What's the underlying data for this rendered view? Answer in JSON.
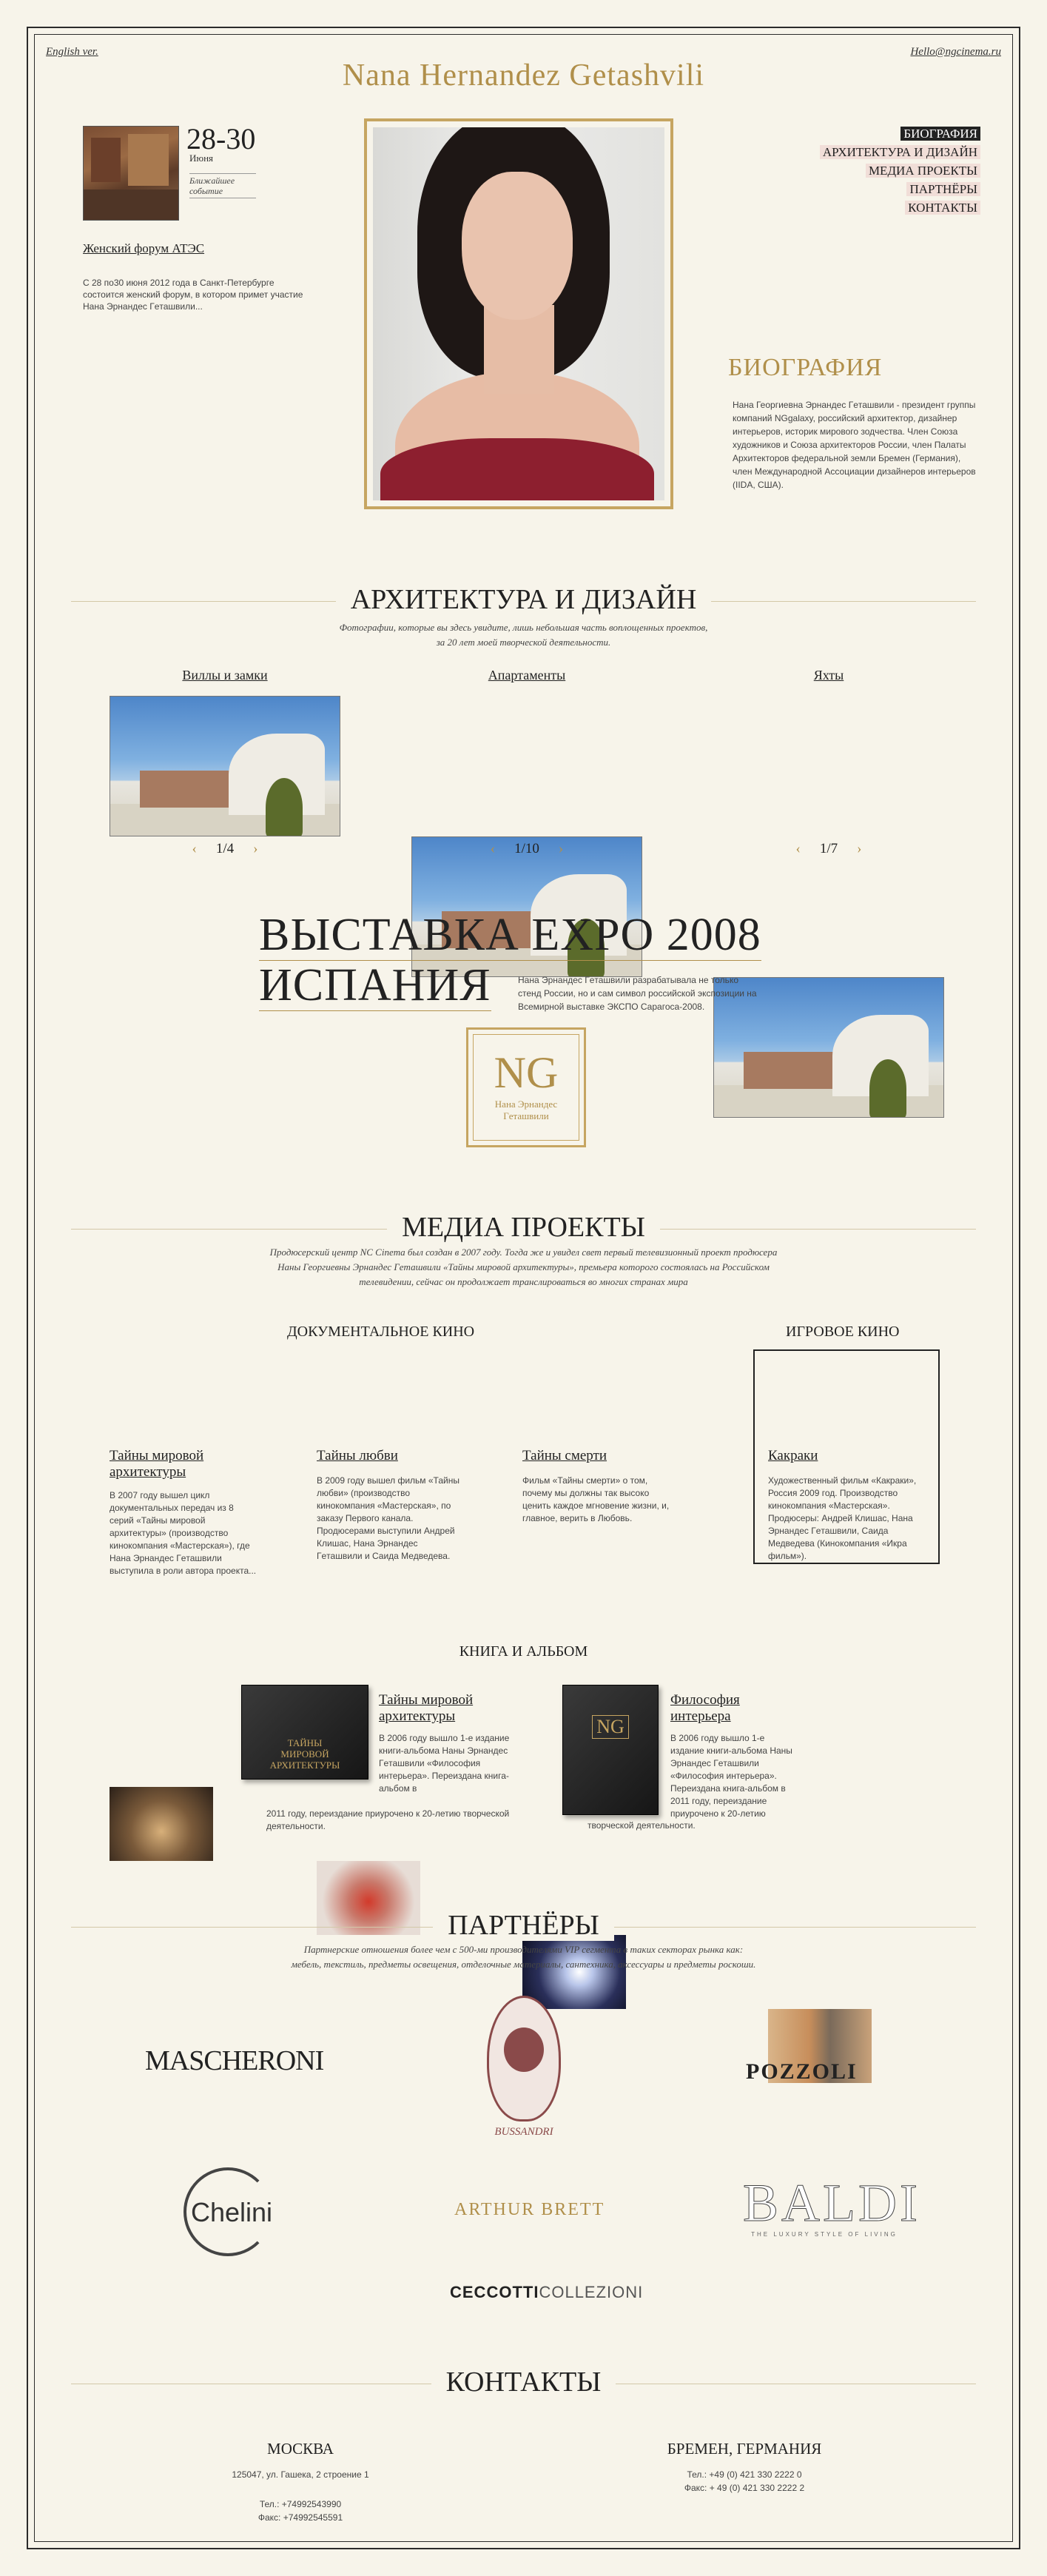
{
  "header": {
    "lang_link": "English ver.",
    "email": "Hello@ngcinema.ru",
    "site_title": "Nana Hernandez Getashvili"
  },
  "event": {
    "date": "28-30",
    "month": "Июня",
    "label": "Ближайшее событие",
    "title": "Женский форум АТЭС",
    "text": "С 28 по30 июня 2012 года в Санкт-Петербурге состоится женский форум, в котором примет участие Нана Эрнандес Гeташвили..."
  },
  "nav": {
    "items": [
      {
        "label": "Биография",
        "active": true
      },
      {
        "label": "Архитектура и дизайн",
        "active": false
      },
      {
        "label": "Медиа проекты",
        "active": false
      },
      {
        "label": "Партнёры",
        "active": false
      },
      {
        "label": "Контакты",
        "active": false
      }
    ]
  },
  "bio": {
    "title": "БИОГРАФИЯ",
    "text": "Нана Георгиевна Эрнандес Гeташвили - президент группы компаний NGgalaxy, российский архитектор, дизайнер интерьеров, историк мирового зодчества. Член Союза художников и Союза архитекторов России, член Палаты Архитекторов федеральной земли Бремен (Германия), член Международной Ассоциации дизайнеров интерьеров (IIDA, США)."
  },
  "architecture": {
    "title": "Архитектура и дизайн",
    "subtitle_1": "Фотографии, которые вы здесь увидите, лишь небольшая часть воплощенных проектов,",
    "subtitle_2": "за 20 лет моей творческой деятельности.",
    "galleries": [
      {
        "label": "Виллы и замки",
        "pager": "1/4"
      },
      {
        "label": "Апартаменты",
        "pager": "1/10"
      },
      {
        "label": "Яхты",
        "pager": "1/7"
      }
    ],
    "prev_arrow": "‹",
    "next_arrow": "›"
  },
  "expo": {
    "line1": "Выставка EXPO 2008",
    "line2": "Испания",
    "text": "Нана Эрнандес Гeташвили разрабатывала не только стенд России, но и сам символ российской экспозиции на Всемирной выставке ЭКСПО Сарагоса-2008.",
    "logo_mark": "NG",
    "logo_caption_1": "Нана Эрнандес",
    "logo_caption_2": "Гeташвили"
  },
  "media": {
    "title": "Медиа проекты",
    "subtitle_1": "Продюсерский центр NC Cinema был создан в 2007 году. Тогда же и увидел свет первый телевизионный проект продюсера",
    "subtitle_2": "Наны Георгиевны Эрнандес Гeташвили «Тайны мировой архитектуры», премьера которого состоялась на Российском",
    "subtitle_3": "телевидении, сейчас он продолжает транслироваться во многих странах мира",
    "documentary_head": "Документальное кино",
    "feature_head": "Игровое кино",
    "films": [
      {
        "title": "Тайны мировой архитектуры",
        "text": "В 2007 году вышел цикл документальных передач из 8 серий «Тайны мировой архитектуры» (производство кинокомпания «Мастерская»), где Нана Эрнандес Гeташвили выступила в роли автора проекта..."
      },
      {
        "title": "Тайны любви",
        "text": "В 2009 году вышел фильм «Тайны любви» (производство кинокомпания «Мастерская», по заказу Первого канала. Продюсерами выступили Андрей Клишас, Нана Эрнандес Гeташвили и Саида Медведева."
      },
      {
        "title": "Тайны смерти",
        "text": "Фильм «Тайны смерти» о том, почему мы должны так высоко ценить каждое мгновение жизни, и, главное, верить в Любовь."
      },
      {
        "title": "Какраки",
        "text": "Художественный фильм «Какраки», Россия 2009 год. Производство кинокомпания «Мастерская». Продюсеры: Андрей Клишас, Нана Эрнандес Гeташвили, Саида Медведева (Кинокомпания «Икра фильм»)."
      }
    ]
  },
  "books": {
    "head": "Книга и альбом",
    "items": [
      {
        "title": "Тайны мировой архитектуры",
        "cover_text": "ТАЙНЫ МИРОВОЙ АРХИТЕКТУРЫ",
        "text_1": "В 2006 году вышло 1-е издание книги-альбома Наны Эрнандес Гeташвили «Философия интерьера». Переиздана книга-альбом в",
        "text_2": "2011 году, переиздание приурочено к 20-летию творческой деятельности."
      },
      {
        "title": "Философия интерьера",
        "cover_text": "NG",
        "text_1": "В 2006 году вышло 1-е издание книги-альбома Наны Эрнандес Гeташвили «Философия интерьера». Переиздана книга-альбом в 2011 году, переиздание приурочено к 20-летию",
        "text_2": "творческой деятельности."
      }
    ]
  },
  "partners": {
    "title": "Партнёры",
    "subtitle_1": "Партнерские отношения более чем с 500-ми производителями VIP сегмента в таких секторах рынка как:",
    "subtitle_2": "мебель, текстиль, предметы освещения, отделочные материалы, сантехника, аксессуары и предметы роскоши.",
    "brands": [
      "MASCHERONI",
      "BUSSANDRI",
      "POZZOLI",
      "Chelini",
      "ARTHUR BRETT",
      "BALDI",
      "THE LUXURY STYLE OF LIVING",
      "CECCOTTI",
      "COLLEZIONI"
    ]
  },
  "contacts": {
    "title": "Контакты",
    "moscow": {
      "city": "Москва",
      "address": "125047, ул. Гашека, 2 строение 1",
      "phone": "Тел.: +74992543990",
      "fax": "Факс: +74992545591"
    },
    "bremen": {
      "city": "Бремен, Германия",
      "phone": "Тел.: +49 (0) 421 330 2222 0",
      "fax": "Факс: + 49 (0) 421 330 2222 2"
    }
  },
  "colors": {
    "background": "#f7f4ea",
    "gold": "#b08f4a",
    "frame": "#2b2b2b",
    "nav_active": "#222222"
  }
}
